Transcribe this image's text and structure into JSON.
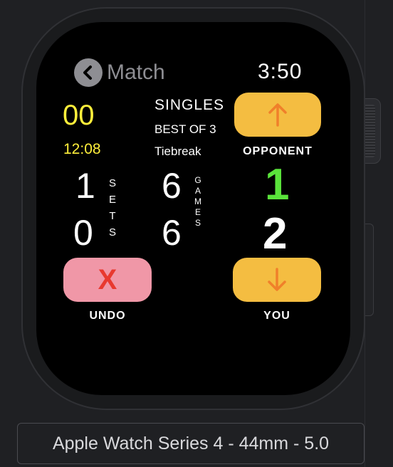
{
  "header": {
    "back_label": "Match",
    "time": "3:50"
  },
  "left": {
    "points": "00",
    "timer": "12:08",
    "sets_you": "1",
    "sets_opponent": "0",
    "sets_label": [
      "S",
      "E",
      "T",
      "S"
    ]
  },
  "middle": {
    "mode": "SINGLES",
    "format": "BEST OF 3",
    "tiebreak": "Tiebreak",
    "games_top": "6",
    "games_bottom": "6",
    "games_label": [
      "G",
      "A",
      "M",
      "E",
      "S"
    ]
  },
  "right": {
    "opponent_label": "OPPONENT",
    "opponent_score": "1",
    "you_score": "2",
    "you_label": "YOU"
  },
  "undo": {
    "icon_glyph": "X",
    "label": "UNDO"
  },
  "device": {
    "name": "Apple Watch Series 4 - 44mm - 5.0"
  },
  "colors": {
    "yellow_accent": "#ffef3b",
    "button_yellow": "#f4bd41",
    "arrow_orange": "#f0802a",
    "undo_pink": "#f097a7",
    "undo_x_red": "#e8392f",
    "score_green": "#5ae33b"
  },
  "icons": {
    "back": "chevron-left-icon",
    "up": "arrow-up-icon",
    "down": "arrow-down-icon",
    "undo": "x-icon"
  }
}
